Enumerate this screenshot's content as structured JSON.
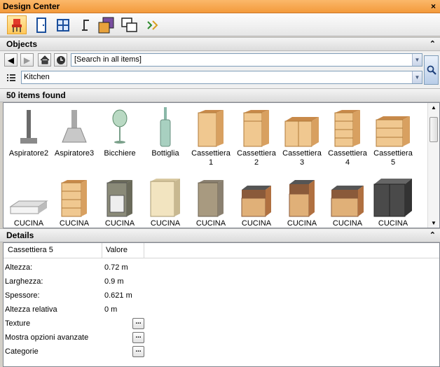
{
  "window": {
    "title": "Design Center",
    "close_glyph": "×"
  },
  "toolbar": {
    "buttons": [
      {
        "icon": "chair-icon"
      },
      {
        "icon": "door-icon"
      },
      {
        "icon": "window-icon"
      },
      {
        "icon": "lamp-icon"
      },
      {
        "icon": "material-icon"
      },
      {
        "icon": "view-icon"
      },
      {
        "icon": "transform-icon"
      }
    ]
  },
  "objects": {
    "header": "Objects",
    "collapse_glyph": "⌃",
    "search_placeholder": "[Search in all items]",
    "category": "Kitchen"
  },
  "results": {
    "count_label": "50 items found",
    "items": [
      {
        "label": "Aspiratore2"
      },
      {
        "label": "Aspiratore3"
      },
      {
        "label": "Bicchiere"
      },
      {
        "label": "Bottiglia"
      },
      {
        "label": "Cassettiera 1"
      },
      {
        "label": "Cassettiera 2"
      },
      {
        "label": "Cassettiera 3"
      },
      {
        "label": "Cassettiera 4"
      },
      {
        "label": "Cassettiera 5"
      },
      {
        "label": "CUCINA"
      },
      {
        "label": "CUCINA"
      },
      {
        "label": "CUCINA"
      },
      {
        "label": "CUCINA"
      },
      {
        "label": "CUCINA"
      },
      {
        "label": "CUCINA"
      },
      {
        "label": "CUCINA"
      },
      {
        "label": "CUCINA"
      },
      {
        "label": "CUCINA"
      }
    ]
  },
  "details": {
    "header": "Details",
    "col_name": "Cassettiera 5",
    "col_value": "Valore",
    "rows": [
      {
        "key": "Altezza:",
        "value": "0.72 m"
      },
      {
        "key": "Larghezza:",
        "value": "0.9 m"
      },
      {
        "key": "Spessore:",
        "value": "0.621 m"
      },
      {
        "key": "Altezza relativa",
        "value": "0 m"
      },
      {
        "key": "Texture",
        "value": "..."
      },
      {
        "key": "Mostra opzioni avanzate",
        "value": "..."
      },
      {
        "key": "Categorie",
        "value": "..."
      }
    ]
  },
  "colors": {
    "title_bar": "#f7a74b",
    "active_tool": "#ffc85a"
  }
}
